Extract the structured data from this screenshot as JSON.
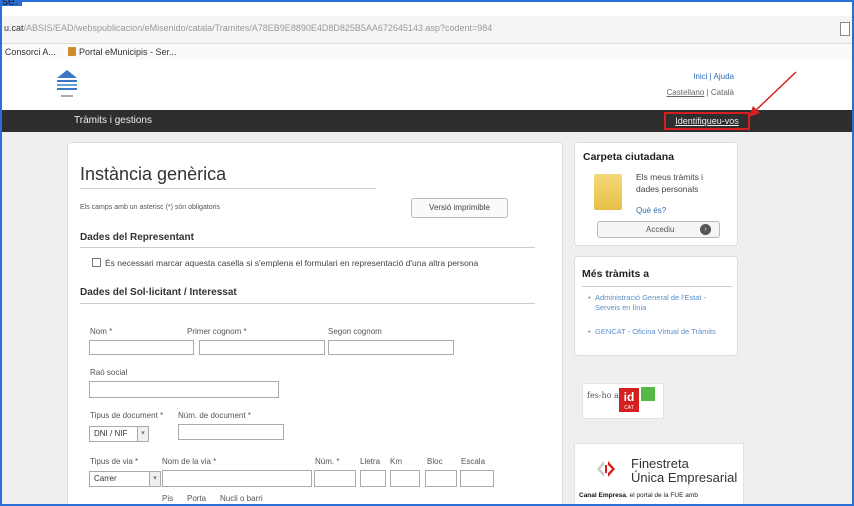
{
  "browser": {
    "top_cut_text": "se:",
    "url_host": "u.cat",
    "url_path": "/ABSIS/EAD/webspublicacion/eMisenido/catala/Tramites/A78EB9E8890E4D8D825B5AA672645143.asp?codent=984",
    "bookmarks": [
      "Consorci A...",
      "Portal eMunicipis - Ser..."
    ]
  },
  "header": {
    "top_links": "Inici | Ajuda",
    "lang_castellano": "Castellano",
    "lang_separator": " | ",
    "lang_catala": "Català"
  },
  "navbar": {
    "title": "Tràmits i gestions",
    "login": "Identifiqueu-vos"
  },
  "form": {
    "title": "Instància genèrica",
    "required_note": "Els camps amb un asterisc (*) són obligatoris",
    "print_button": "Versió imprimible",
    "section_representant": "Dades del Representant",
    "checkbox_label": "És necessari marcar aquesta casella si s'emplena el formulari en representació d'una altra persona",
    "section_sollicitant": "Dades del Sol·licitant / Interessat",
    "label_nom": "Nom *",
    "label_primer_cognom": "Primer cognom *",
    "label_segon_cognom": "Segon cognom",
    "label_rao_social": "Raó social",
    "label_tipus_document": "Tipus de document *",
    "label_num_document": "Núm. de document *",
    "tipus_document_value": "DNI / NIF",
    "label_tipus_via": "Tipus de via *",
    "label_nom_via": "Nom de la via *",
    "label_num": "Núm. *",
    "label_lletra": "Lletra",
    "label_km": "Km",
    "label_bloc": "Bloc",
    "label_escala": "Escala",
    "tipus_via_value": "Carrer",
    "label_pis": "Pis",
    "label_porta": "Porta",
    "label_nucli": "Nucli o barri"
  },
  "sidebar": {
    "carpeta_title": "Carpeta ciutadana",
    "carpeta_text": "Els meus tràmits i dades personals",
    "carpeta_link": "Què és?",
    "access_button": "Accediu",
    "mes_tramits_title": "Més tràmits a",
    "links": [
      "Administració General de l'Estat - Serveis en línia",
      "GENCAT - Oficina Virtual de Tràmits"
    ],
    "idcat": {
      "fes_ho": "fes-ho amb",
      "id": "id",
      "cat": "CAT"
    },
    "fue": {
      "title_line1": "Finestreta",
      "title_line2": "Única Empresarial",
      "caption_bold": "Canal Empresa",
      "caption_rest": ", el portal de la FUE amb"
    }
  }
}
